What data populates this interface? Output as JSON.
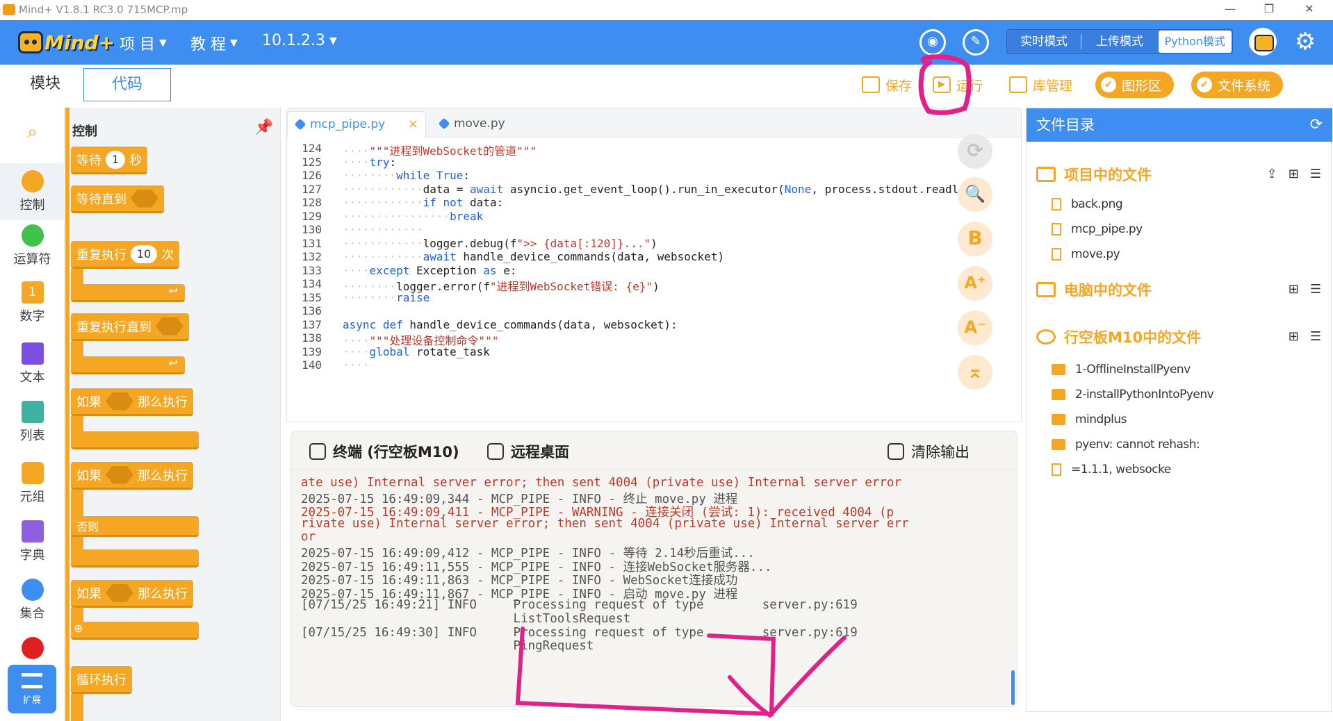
{
  "window": {
    "title": "Mind+ V1.8.1 RC3.0   715MCP.mp",
    "controls": [
      "—",
      "❐",
      "✕"
    ]
  },
  "header": {
    "brand": "Mind+",
    "menus": [
      {
        "label": "项 目"
      },
      {
        "label": "教 程"
      },
      {
        "label": "10.1.2.3"
      }
    ],
    "modes": {
      "realtime": "实时模式",
      "upload": "上传模式",
      "python": "Python模式"
    },
    "active_mode": "python"
  },
  "toolbar": {
    "blocks_tab": "模块",
    "code_tab": "代码",
    "save": "保存",
    "run": "运行",
    "library": "库管理",
    "graphic_area": "图形区",
    "file_system": "文件系统"
  },
  "categories": [
    {
      "label": "控制",
      "color": "#f5a623"
    },
    {
      "label": "运算符",
      "color": "#3fc14a"
    },
    {
      "label": "数字",
      "color": "#f5a623"
    },
    {
      "label": "文本",
      "color": "#7b4fe0"
    },
    {
      "label": "列表",
      "color": "#3fb3a0"
    },
    {
      "label": "元组",
      "color": "#f5a623"
    },
    {
      "label": "字典",
      "color": "#8e5fe0"
    },
    {
      "label": "集合",
      "color": "#3e8df0"
    },
    {
      "label": "",
      "color": "#e02020"
    }
  ],
  "extend_label": "扩展",
  "palette": {
    "title": "控制",
    "blocks": {
      "wait": "等待",
      "wait_value": "1",
      "wait_unit": "秒",
      "wait_until": "等待直到",
      "repeat": "重复执行",
      "repeat_value": "10",
      "repeat_unit": "次",
      "repeat_until": "重复执行直到",
      "if": "如果",
      "then": "那么执行",
      "else": "否则",
      "loop": "循环执行"
    }
  },
  "editor": {
    "tabs": [
      {
        "name": "mcp_pipe.py",
        "active": true,
        "close": "×"
      },
      {
        "name": "move.py",
        "active": false
      }
    ],
    "lines": [
      {
        "n": "124",
        "indent": 1,
        "html": "<span class='st'>\"\"\"进程到WebSocket的管道\"\"\"</span>"
      },
      {
        "n": "125",
        "indent": 1,
        "html": "<span class='kw'>try</span>:"
      },
      {
        "n": "126",
        "indent": 2,
        "html": "<span class='kw'>while</span> <span class='cn'>True</span>:"
      },
      {
        "n": "127",
        "indent": 3,
        "html": "data = <span class='kw'>await</span> asyncio.get_event_loop().run_in_executor(<span class='cn'>None</span>, process.stdout.readl"
      },
      {
        "n": "128",
        "indent": 3,
        "html": "<span class='kw'>if</span> <span class='kw'>not</span> data:"
      },
      {
        "n": "129",
        "indent": 4,
        "html": "<span class='kw'>break</span>"
      },
      {
        "n": "130",
        "indent": 3,
        "html": ""
      },
      {
        "n": "131",
        "indent": 3,
        "html": "logger.debug(f<span class='st'>\"&gt;&gt; {data[:120]}...\"</span>)"
      },
      {
        "n": "132",
        "indent": 3,
        "html": "<span class='kw'>await</span> handle_device_commands(data, websocket)"
      },
      {
        "n": "133",
        "indent": 1,
        "html": "<span class='kw'>except</span> Exception <span class='kw'>as</span> e:"
      },
      {
        "n": "134",
        "indent": 2,
        "html": "logger.error(f<span class='st'>\"进程到WebSocket错误: {e}\"</span>)"
      },
      {
        "n": "135",
        "indent": 2,
        "html": "<span class='kw'>raise</span>"
      },
      {
        "n": "136",
        "indent": 0,
        "html": ""
      },
      {
        "n": "137",
        "indent": 0,
        "html": "<span class='kw'>async</span> <span class='kw'>def</span> handle_device_commands(data, websocket):"
      },
      {
        "n": "138",
        "indent": 1,
        "html": "<span class='st'>\"\"\"处理设备控制命令\"\"\"</span>"
      },
      {
        "n": "139",
        "indent": 1,
        "html": "<span class='kw'>global</span> rotate_task"
      },
      {
        "n": "140",
        "indent": 1,
        "html": ""
      }
    ],
    "side_tools": [
      "⟳",
      "🔍",
      "B",
      "A⁺",
      "A⁻",
      "⌅"
    ]
  },
  "terminal": {
    "tab_terminal": "终端 (行空板M10)",
    "tab_remote": "远程桌面",
    "clear": "清除输出",
    "lines": [
      {
        "t": "ate use) Internal server error; then sent 4004 (private use) Internal server error",
        "err": true
      },
      {
        "t": "2025-07-15 16:49:09,344 - MCP_PIPE - INFO - 终止 move.py 进程",
        "err": false
      },
      {
        "t": "2025-07-15 16:49:09,411 - MCP_PIPE - WARNING - 连接关闭 (尝试: 1): received 4004 (p",
        "err": true
      },
      {
        "t": "rivate use) Internal server error; then sent 4004 (private use) Internal server err",
        "err": true
      },
      {
        "t": "or",
        "err": true
      },
      {
        "t": "2025-07-15 16:49:09,412 - MCP_PIPE - INFO - 等待 2.14秒后重试...",
        "err": false
      },
      {
        "t": "2025-07-15 16:49:11,555 - MCP_PIPE - INFO - 连接WebSocket服务器...",
        "err": false
      },
      {
        "t": "2025-07-15 16:49:11,863 - MCP_PIPE - INFO - WebSocket连接成功",
        "err": false
      },
      {
        "t": "2025-07-15 16:49:11,867 - MCP_PIPE - INFO - 启动 move.py 进程",
        "err": false
      },
      {
        "t": "[07/15/25 16:49:21] INFO     Processing request of type        server.py:619",
        "err": false
      },
      {
        "t": "                             ListToolsRequest",
        "err": false
      },
      {
        "t": "[07/15/25 16:49:30] INFO     Processing request of type        server.py:619",
        "err": false
      },
      {
        "t": "                             PingRequest",
        "err": false
      }
    ]
  },
  "files": {
    "title": "文件目录",
    "project_section": "项目中的文件",
    "project_files": [
      "back.png",
      "mcp_pipe.py",
      "move.py"
    ],
    "pc_section": "电脑中的文件",
    "board_section": "行空板M10中的文件",
    "board_files": [
      {
        "name": "1-OfflineInstallPyenv",
        "type": "folder"
      },
      {
        "name": "2-installPythonIntoPyenv",
        "type": "folder"
      },
      {
        "name": "mindplus",
        "type": "folder"
      },
      {
        "name": "pyenv: cannot rehash:",
        "type": "folder"
      },
      {
        "name": "=1.1.1,  websocke",
        "type": "file"
      }
    ]
  },
  "colors": {
    "accent": "#3e8df0",
    "block": "#f5a623",
    "annotation": "#e0218a"
  }
}
